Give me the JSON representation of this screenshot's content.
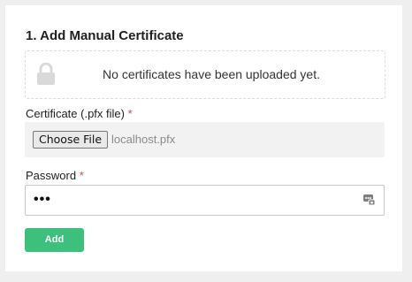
{
  "section": {
    "title": "1. Add Manual Certificate",
    "empty_message": "No certificates have been uploaded yet.",
    "empty_icon": "lock-icon"
  },
  "certificate": {
    "label": "Certificate (.pfx file)",
    "required_mark": "*",
    "choose_button": "Choose File",
    "file_name": "localhost.pfx"
  },
  "password": {
    "label": "Password",
    "required_mark": "*",
    "value_masked": "•••",
    "icon": "password-manager-icon"
  },
  "actions": {
    "add_label": "Add"
  },
  "colors": {
    "accent": "#3ec07d",
    "required": "#e04545"
  }
}
